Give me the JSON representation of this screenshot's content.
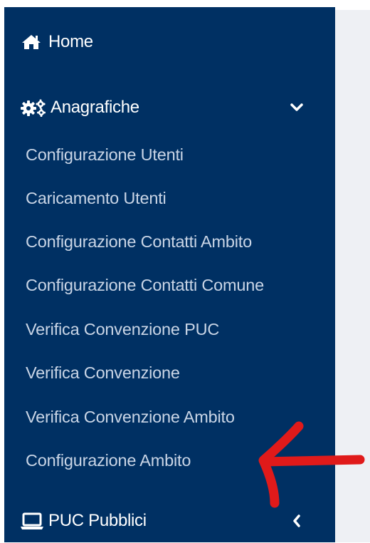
{
  "sidebar": {
    "home": {
      "label": "Home",
      "icon": "home-icon"
    },
    "anagrafiche": {
      "label": "Anagrafiche",
      "icon": "cogs-icon",
      "expanded": true,
      "items": [
        {
          "label": "Configurazione Utenti"
        },
        {
          "label": "Caricamento Utenti"
        },
        {
          "label": "Configurazione Contatti Ambito"
        },
        {
          "label": "Configurazione Contatti Comune"
        },
        {
          "label": "Verifica Convenzione PUC"
        },
        {
          "label": "Verifica Convenzione"
        },
        {
          "label": "Verifica Convenzione Ambito"
        },
        {
          "label": "Configurazione Ambito"
        }
      ]
    },
    "puc_pubblici": {
      "label": "PUC Pubblici",
      "icon": "laptop-icon",
      "expanded": false
    }
  },
  "annotation": {
    "type": "hand-drawn-arrow",
    "color": "#e01a1a",
    "points_to": "Configurazione Ambito"
  },
  "colors": {
    "sidebar_bg": "#003063",
    "submenu_text": "#c9d5e6",
    "main_bg": "#eef0f4"
  }
}
